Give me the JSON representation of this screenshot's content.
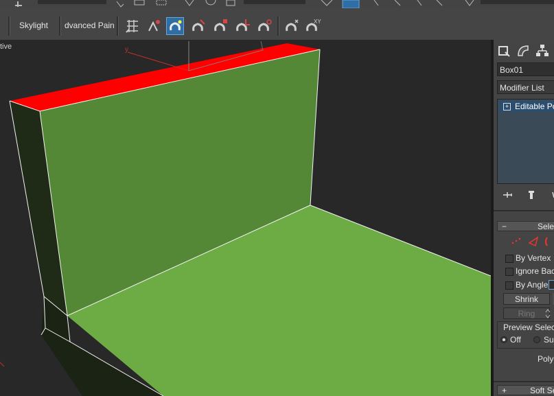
{
  "toolbar": {
    "skylight_label": "Skylight",
    "advanced_paint_label": "dvanced Paint"
  },
  "viewport": {
    "label": "tive",
    "axis_y": "y",
    "axis_x": "x",
    "colors": {
      "wall": "#548836",
      "floor": "#6dab45",
      "top_selected": "#ff0000",
      "side": "#1f2a17",
      "edges": "#ffffff",
      "background": "#282828"
    }
  },
  "command_panel": {
    "object_name": "Box01",
    "modifier_list_label": "Modifier List",
    "stack_item": "Editable Poly",
    "selection_rollout_title": "Selec",
    "by_vertex_label": "By Vertex",
    "ignore_backfacing_label": "Ignore Back",
    "by_angle_label": "By Angle:",
    "shrink_label": "Shrink",
    "ring_label": "Ring",
    "preview_selection_label": "Preview Selecti",
    "preview_off_label": "Off",
    "preview_subobj_label": "Su",
    "polys_label": "Polyg",
    "soft_selection_title": "Soft Se",
    "collapse_minus": "−",
    "expand_plus": "+"
  }
}
